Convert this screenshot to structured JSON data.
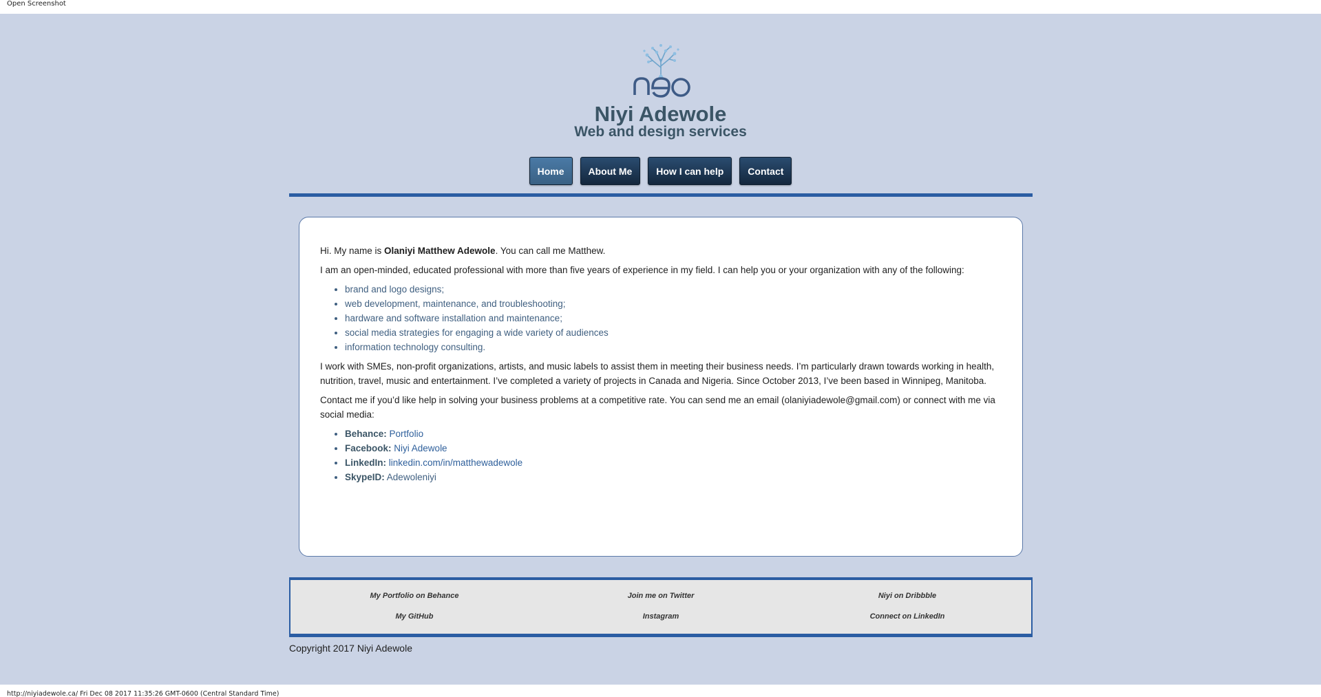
{
  "window": {
    "top_label": "Open Screenshot",
    "status_line": "http://niyiadewole.ca/ Fri Dec 08 2017 11:35:26 GMT-0600 (Central Standard Time)"
  },
  "header": {
    "logo_text": "neo",
    "title": "Niyi Adewole",
    "subtitle": "Web and design services"
  },
  "nav": {
    "items": [
      {
        "label": "Home",
        "active": true
      },
      {
        "label": "About Me",
        "active": false
      },
      {
        "label": "How I can help",
        "active": false
      },
      {
        "label": "Contact",
        "active": false
      }
    ]
  },
  "main": {
    "intro_before": "Hi. My name is ",
    "intro_name": "Olaniyi Matthew Adewole",
    "intro_after": ". You can call me Matthew.",
    "p2": "I am an open-minded, educated professional with more than five years of experience in my field. I can help you or your organization with any of the following:",
    "services": [
      "brand and logo designs;",
      "web development, maintenance, and troubleshooting;",
      "hardware and software installation and maintenance;",
      "social media strategies for engaging a wide variety of audiences",
      "information technology consulting."
    ],
    "p3": "I work with SMEs, non-profit organizations, artists, and music labels to assist them in meeting their business needs. I’m particularly drawn towards working in health, nutrition, travel, music and entertainment. I’ve completed a variety of projects in Canada and Nigeria. Since October 2013, I’ve been based in Winnipeg, Manitoba.",
    "p4": "Contact me if you’d like help in solving your business problems at a competitive rate. You can send me an email (olaniyiadewole@gmail.com) or connect with me via social media:",
    "social": [
      {
        "label": "Behance:",
        "value": "Portfolio"
      },
      {
        "label": "Facebook:",
        "value": "Niyi Adewole"
      },
      {
        "label": "LinkedIn:",
        "value": "linkedin.com/in/matthewadewole"
      },
      {
        "label": "SkypeID:",
        "value": "Adewoleniyi"
      }
    ]
  },
  "footer": {
    "links": [
      "My Portfolio on Behance",
      "Join me on Twitter",
      "Niyi on Dribbble",
      "My GitHub",
      "Instagram",
      "Connect on LinkedIn"
    ],
    "copyright": "Copyright 2017 Niyi Adewole"
  },
  "colors": {
    "page_background": "#cad3e5",
    "accent_rule": "#2b5da3",
    "nav_button": "#1f3a57",
    "nav_active": "#42709a",
    "title_text": "#3b5566"
  }
}
